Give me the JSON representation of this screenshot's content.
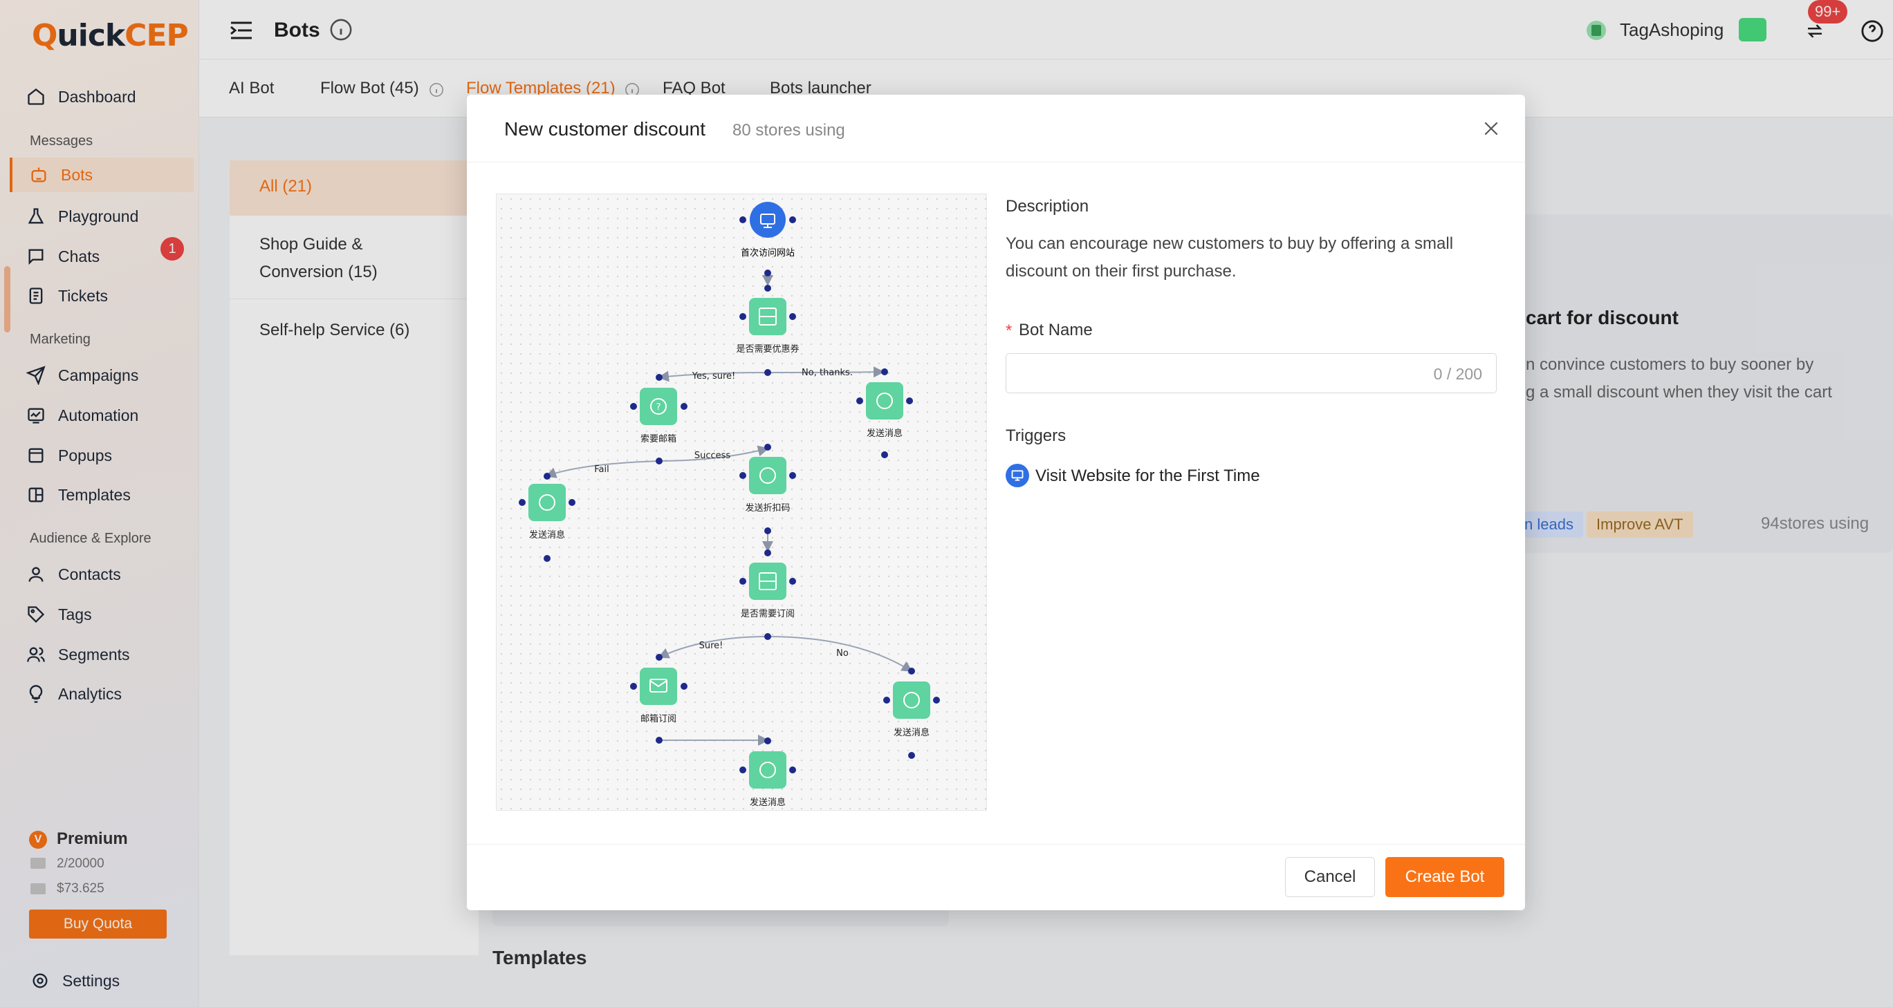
{
  "app": {
    "logo_prefix": "Q",
    "logo_main": "uick",
    "logo_suffix": "CEP"
  },
  "header": {
    "title": "Bots",
    "store_name": "TagAshoping",
    "notif_count": "99+"
  },
  "sidebar": {
    "dashboard": "Dashboard",
    "section_messages": "Messages",
    "bots": "Bots",
    "playground": "Playground",
    "chats": "Chats",
    "chats_badge": "1",
    "tickets": "Tickets",
    "section_marketing": "Marketing",
    "campaigns": "Campaigns",
    "automation": "Automation",
    "popups": "Popups",
    "templates": "Templates",
    "section_audience": "Audience & Explore",
    "contacts": "Contacts",
    "tags": "Tags",
    "segments": "Segments",
    "analytics": "Analytics",
    "plan_badge": "V",
    "plan": "Premium",
    "quota_mail": "2/20000",
    "quota_money": "$73.625",
    "buy_quota": "Buy Quota",
    "settings": "Settings"
  },
  "tabs": {
    "ai_bot": "AI Bot",
    "flow_bot": "Flow Bot (45)",
    "flow_templates": "Flow Templates (21)",
    "faq_bot": "FAQ Bot",
    "bots_launcher": "Bots launcher"
  },
  "categories": {
    "all": "All (21)",
    "shop_guide_1": "Shop Guide &",
    "shop_guide_2": "Conversion (15)",
    "self_help": "Self-help Service (6)"
  },
  "background_card": {
    "title": "cart for discount",
    "desc_1": "n convince customers to buy sooner by",
    "desc_2": "g a small discount when they visit the cart",
    "tag_1": "n leads",
    "tag_2": "Improve AVT",
    "usage": "94stores using",
    "section_heading": "Templates"
  },
  "modal": {
    "title": "New customer discount",
    "usage": "80 stores using",
    "description_label": "Description",
    "description_1": "You can encourage new customers to buy by offering a small",
    "description_2": "discount on their first purchase.",
    "bot_name_required": "*",
    "bot_name_label": "Bot Name",
    "bot_name_value": "",
    "bot_name_counter": "0 / 200",
    "triggers_label": "Triggers",
    "trigger_1": "Visit Website for the First Time",
    "cancel": "Cancel",
    "create": "Create Bot"
  },
  "flow": {
    "node_start": "首次访问网站",
    "node_ask_coupon": "是否需要优惠券",
    "edge_yes": "Yes, sure!",
    "edge_no_thanks": "No, thanks.",
    "node_ask_email": "索要邮箱",
    "node_send_msg_right": "发送消息",
    "edge_success": "Success",
    "edge_fail": "Fail",
    "node_send_code": "发送折扣码",
    "node_send_msg_left": "发送消息",
    "node_ask_subscribe": "是否需要订阅",
    "edge_sure": "Sure!",
    "edge_no": "No",
    "node_email_subscribe": "邮箱订阅",
    "node_send_msg_r2": "发送消息",
    "node_send_msg_bottom": "发送消息"
  },
  "colors": {
    "accent": "#f97316",
    "node": "#5fd3a0",
    "start_node": "#2f6fe4",
    "port": "#1e2a8a",
    "danger": "#ef4444"
  }
}
